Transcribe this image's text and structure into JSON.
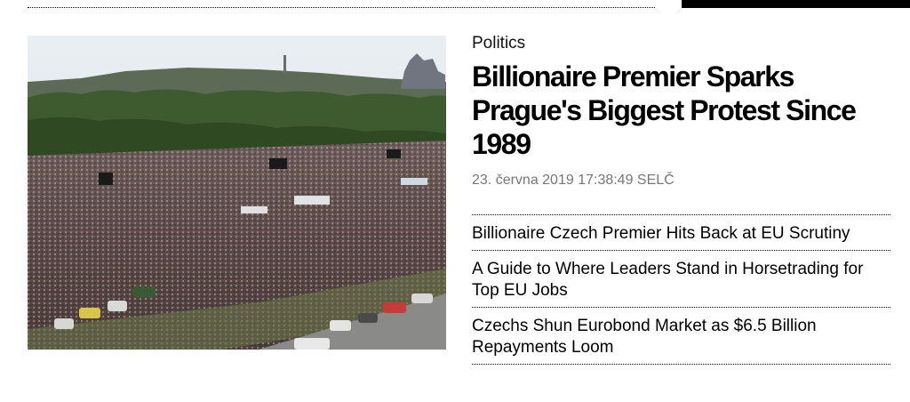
{
  "article": {
    "category": "Politics",
    "headline": "Billionaire Premier Sparks Prague's Biggest Protest Since 1989",
    "timestamp": "23. června 2019 17:38:49 SELČ"
  },
  "related": [
    {
      "title": "Billionaire Czech Premier Hits Back at EU Scrutiny"
    },
    {
      "title": "A Guide to Where Leaders Stand in Horsetrading for Top EU Jobs"
    },
    {
      "title": "Czechs Shun Eurobond Market as $6.5 Billion Repayments Loom"
    }
  ]
}
